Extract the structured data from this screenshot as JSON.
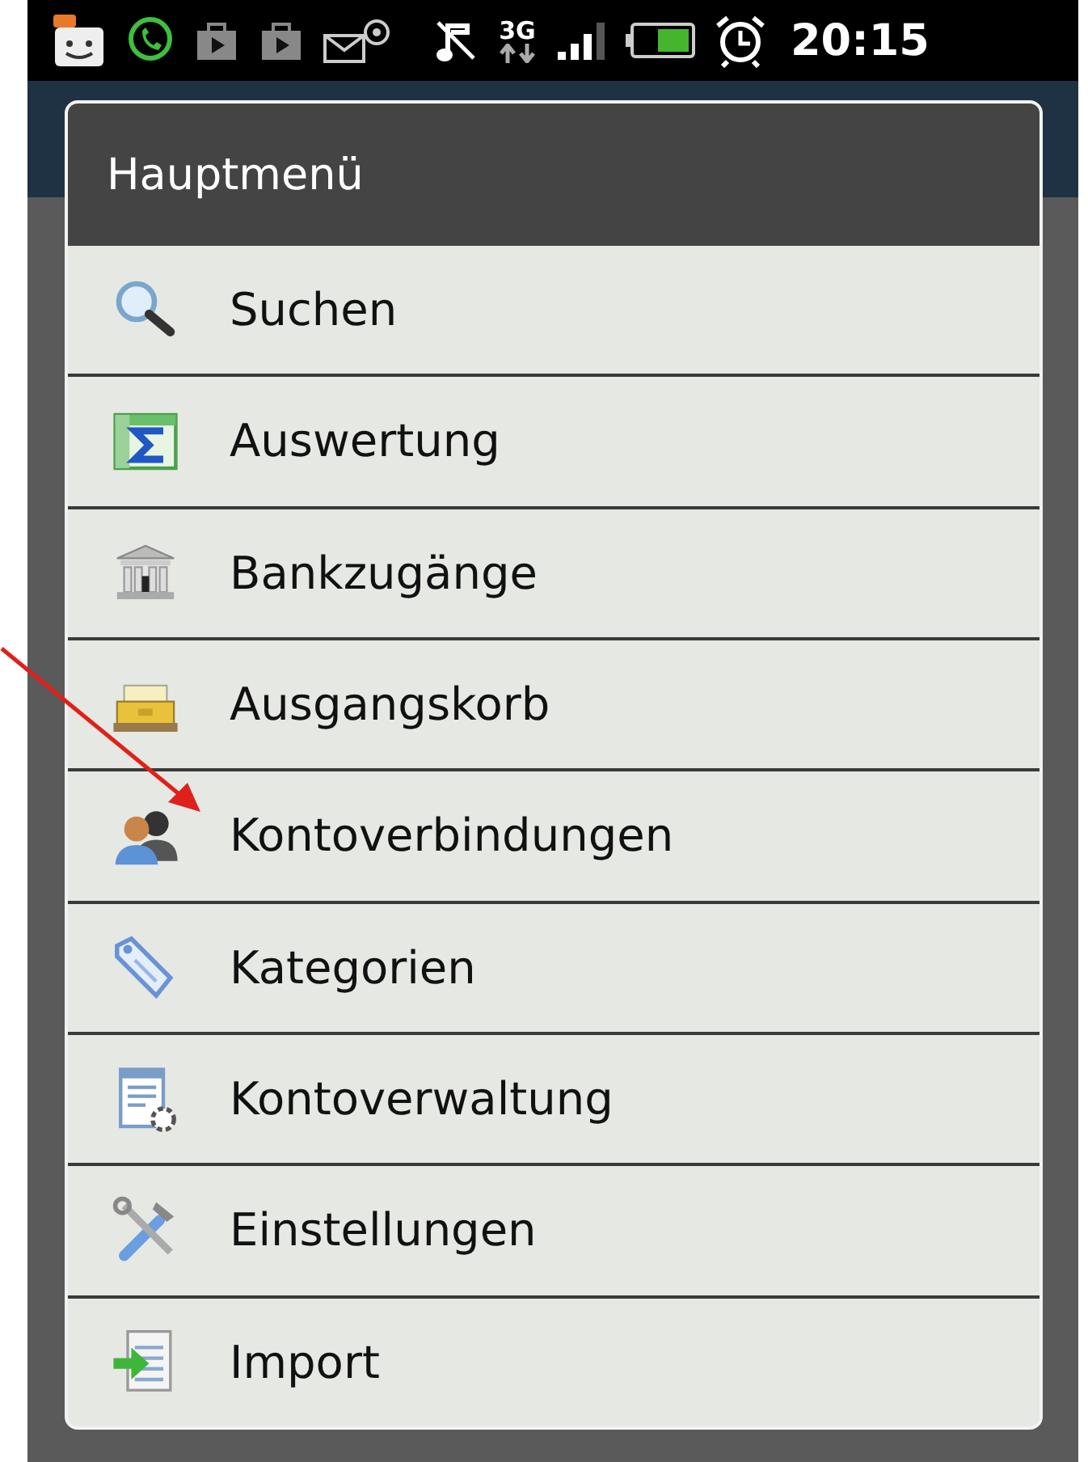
{
  "status_bar": {
    "time": "20:15",
    "network": "3G"
  },
  "dialog": {
    "title": "Hauptmenü",
    "items": [
      {
        "label": "Suchen"
      },
      {
        "label": "Auswertung"
      },
      {
        "label": "Bankzugänge"
      },
      {
        "label": "Ausgangskorb"
      },
      {
        "label": "Kontoverbindungen"
      },
      {
        "label": "Kategorien"
      },
      {
        "label": "Kontoverwaltung"
      },
      {
        "label": "Einstellungen"
      },
      {
        "label": "Import"
      }
    ]
  }
}
